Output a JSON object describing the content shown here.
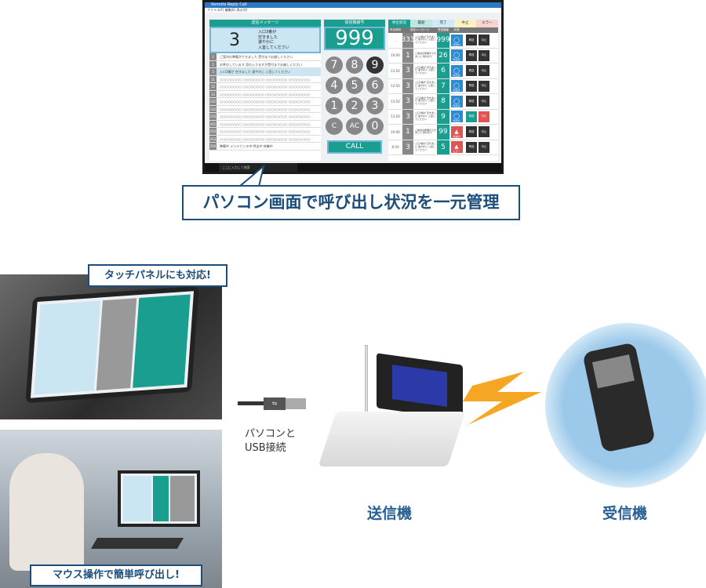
{
  "app": {
    "title": "Remote Reply Call",
    "menu": "ファイル(F)  編集(E)  表示(V)",
    "send_panel": {
      "header": "送信メッセージ",
      "number": "3",
      "message": [
        "入口3番が",
        "空きました",
        "速やかに",
        "入室してください"
      ],
      "list": [
        {
          "n": "1",
          "t": "ご案内の準備ができました  受付までお越しください",
          "sel": false
        },
        {
          "n": "2",
          "t": "お呼びしています  恐れ入りますが受付までお越しください",
          "sel": false
        },
        {
          "n": "3",
          "t": "入口3番が 空きました 速やかに 入室してください",
          "sel": true
        },
        {
          "n": "11",
          "t": "○○○○○○○○ ○○○○○○○○ ○○○○○○○○ ○○○○○○○○",
          "sel": false
        },
        {
          "n": "12",
          "t": "○○○○○○○○ ○○○○○○○○ ○○○○○○○○ ○○○○○○○○",
          "sel": false
        },
        {
          "n": "13",
          "t": "○○○○○○○○ ○○○○○○○○ ○○○○○○○○ ○○○○○○○○",
          "sel": false
        },
        {
          "n": "101",
          "t": "○○○○○○○○ ○○○○○○○○ ○○○○○○○○ ○○○○○○○○",
          "sel": false
        },
        {
          "n": "102",
          "t": "○○○○○○○○ ○○○○○○○○ ○○○○○○○○ ○○○○○○○○",
          "sel": false
        },
        {
          "n": "103",
          "t": "○○○○○○○○ ○○○○○○○○ ○○○○○○○○ ○○○○○○○○",
          "sel": false
        },
        {
          "n": "201",
          "t": "○○○○○○○○ ○○○○○○○○ ○○○○○○○○ ○○○○○○○○",
          "sel": false
        },
        {
          "n": "202",
          "t": "○○○○○○○○ ○○○○○○○○ ○○○○○○○○ ○○○○○○○○",
          "sel": false
        },
        {
          "n": "203",
          "t": "○○○○○○○○ ○○○○○○○○ ○○○○○○○○ ○○○○○○○○",
          "sel": false
        },
        {
          "n": "204",
          "t": "準備中 メンテナンス中 呼出中 待機中",
          "sel": false
        }
      ]
    },
    "receiver_panel": {
      "header": "受信機番号",
      "number": "999",
      "keys": [
        "7",
        "8",
        "9",
        "4",
        "5",
        "6",
        "1",
        "2",
        "3",
        "C",
        "AC",
        "0"
      ],
      "call": "CALL"
    },
    "status_panel": {
      "tabs": [
        {
          "label": "呼出状況",
          "color": "#1a9e8f"
        },
        {
          "label": "履歴",
          "color": "#bfe6e0"
        },
        {
          "label": "完了",
          "color": "#cfe9f5"
        },
        {
          "label": "中止",
          "color": "#fbf0c4"
        },
        {
          "label": "エラー",
          "color": "#f8d3d3"
        }
      ],
      "columns": [
        "呼出時刻",
        "送信メッセージ",
        "受信機番号",
        "状態"
      ],
      "rows": [
        {
          "time": "…",
          "msg": "333",
          "text": "入口3番が 空きました 速やかに 入室してください",
          "rcv": "999",
          "state": "呼出中",
          "err": false
        },
        {
          "time": "10:00",
          "msg": "1",
          "text": "ご案内の準備ができました 受付まで",
          "rcv": "26",
          "state": "呼出済",
          "err": false
        },
        {
          "time": "13:50",
          "msg": "3",
          "text": "入口3番が 空きました 速やかに 入室してください",
          "rcv": "6",
          "state": "呼出済",
          "err": false
        },
        {
          "time": "13:50",
          "msg": "3",
          "text": "入口3番が 空きました 速やかに 入室してください",
          "rcv": "7",
          "state": "呼出済",
          "err": false
        },
        {
          "time": "13:50",
          "msg": "3",
          "text": "入口3番が 空きました 速やかに 入室してください",
          "rcv": "8",
          "state": "呼出済",
          "err": false
        },
        {
          "time": "13:50",
          "msg": "3",
          "text": "入口3番が 空きました 速やかに 入室してください",
          "rcv": "9",
          "state": "呼出済",
          "err": false
        },
        {
          "time": "10:00",
          "msg": "1",
          "text": "ご案内の準備ができました 受付まで",
          "rcv": "99",
          "state": "充電中",
          "err": true
        },
        {
          "time": "9:50",
          "msg": "3",
          "text": "入口3番が 空きました 速やかに 入室してください",
          "rcv": "5",
          "state": "エラー",
          "err": true
        }
      ],
      "resend": "再送",
      "cancel": "中止"
    },
    "taskbar_search": "ここに入力して検索"
  },
  "callouts": {
    "main": "パソコン画面で呼び出し状況を一元管理",
    "touch": "タッチパネルにも対応!",
    "mouse": "マウス操作で簡単呼び出し!"
  },
  "usb": {
    "line1": "パソコンと",
    "line2": "USB接続"
  },
  "labels": {
    "transmitter": "送信機",
    "receiver": "受信機"
  },
  "colors": {
    "teal": "#1a9e8f",
    "navy": "#1d4e7a",
    "bolt": "#f5a623",
    "label": "#2a5f93"
  }
}
